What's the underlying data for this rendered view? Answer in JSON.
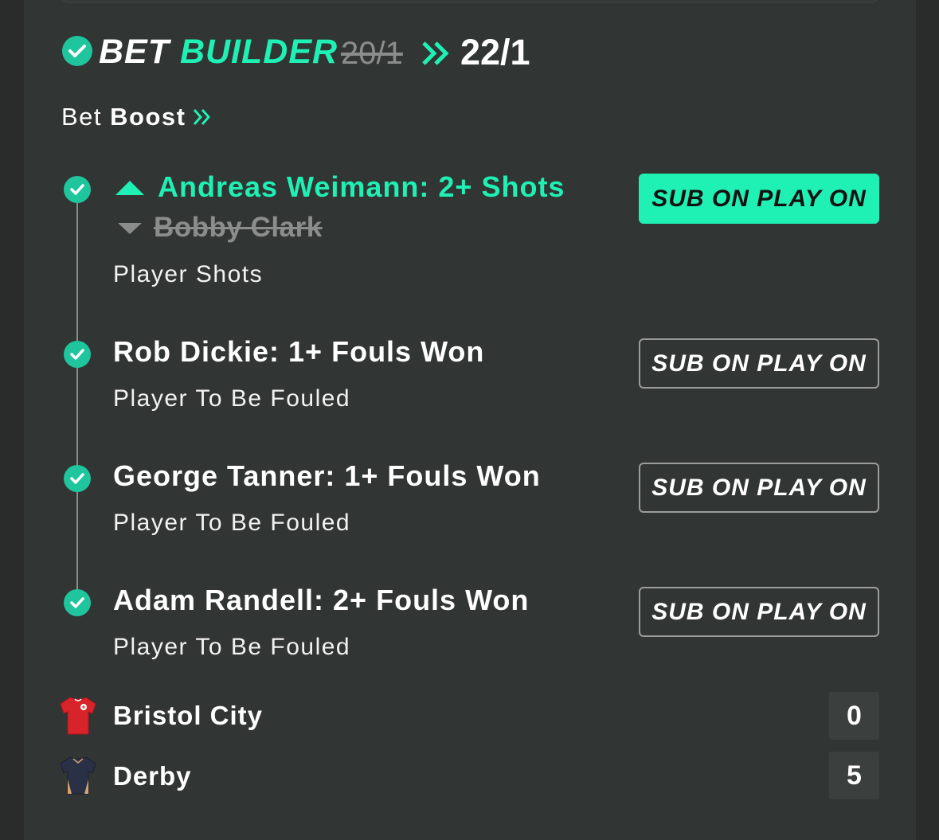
{
  "colors": {
    "accent": "#1ff0b4",
    "check": "#1fc59d",
    "background": "#313534",
    "muted": "#8a8d8c"
  },
  "header": {
    "title_part1": "BET",
    "title_part2": "BUILDER",
    "old_odds": "20/1",
    "new_odds": "22/1",
    "icon": "check-circle-icon"
  },
  "boost": {
    "label_regular": "Bet",
    "label_bold": "Boost"
  },
  "selections": [
    {
      "title": "Andreas Weimann: 2+ Shots",
      "replaced": "Bobby Clark",
      "market": "Player Shots",
      "button": "SUB ON PLAY ON",
      "button_active": true
    },
    {
      "title": "Rob Dickie: 1+ Fouls Won",
      "market": "Player To Be Fouled",
      "button": "SUB ON PLAY ON",
      "button_active": false
    },
    {
      "title": "George Tanner: 1+ Fouls Won",
      "market": "Player To Be Fouled",
      "button": "SUB ON PLAY ON",
      "button_active": false
    },
    {
      "title": "Adam Randell: 2+ Fouls Won",
      "market": "Player To Be Fouled",
      "button": "SUB ON PLAY ON",
      "button_active": false
    }
  ],
  "teams": [
    {
      "name": "Bristol City",
      "score": "0",
      "icon": "red-shirt-icon"
    },
    {
      "name": "Derby",
      "score": "5",
      "icon": "navy-shirt-icon"
    }
  ]
}
